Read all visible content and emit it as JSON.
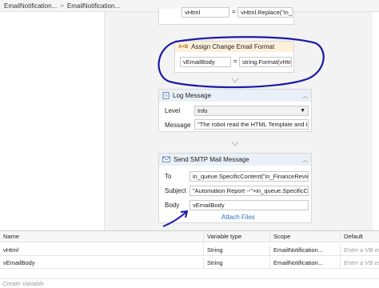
{
  "breadcrumb": {
    "items": [
      "EmailNotification...",
      "EmailNotification..."
    ]
  },
  "assign_top": {
    "to": "vHtml",
    "value": "vHtml.Replace(\"in_"
  },
  "assign": {
    "title": "Assign Change Email Format",
    "to": "vEmailBody",
    "value": "string.Format(vHtml",
    "eq": "="
  },
  "log": {
    "title": "Log Message",
    "level_label": "Level",
    "level_value": "Info",
    "message_label": "Message",
    "message_value": "\"The robot read the HTML Template and it"
  },
  "smtp": {
    "title": "Send SMTP Mail Message",
    "to_label": "To",
    "to_value": "in_queue.SpecificContent(\"in_FinanceReview\"",
    "subject_label": "Subject",
    "subject_value": "\"Automation Report --\"+in_queue.SpecificCo",
    "body_label": "Body",
    "body_value": "vEmailBody",
    "attach": "Attach Files"
  },
  "variables": {
    "headers": [
      "Name",
      "Variable type",
      "Scope",
      "Default"
    ],
    "rows": [
      {
        "name": "vHtml",
        "type": "String",
        "scope": "EmailNotification...",
        "default": "Enter a VB ex"
      },
      {
        "name": "vEmailBody",
        "type": "String",
        "scope": "EmailNotification...",
        "default": "Enter a VB ex"
      }
    ],
    "create": "Create Variable"
  },
  "colors": {
    "annotation": "#1a1aa6",
    "assign_header": "#fdf1dc",
    "header_bg": "#eaf0f7"
  }
}
